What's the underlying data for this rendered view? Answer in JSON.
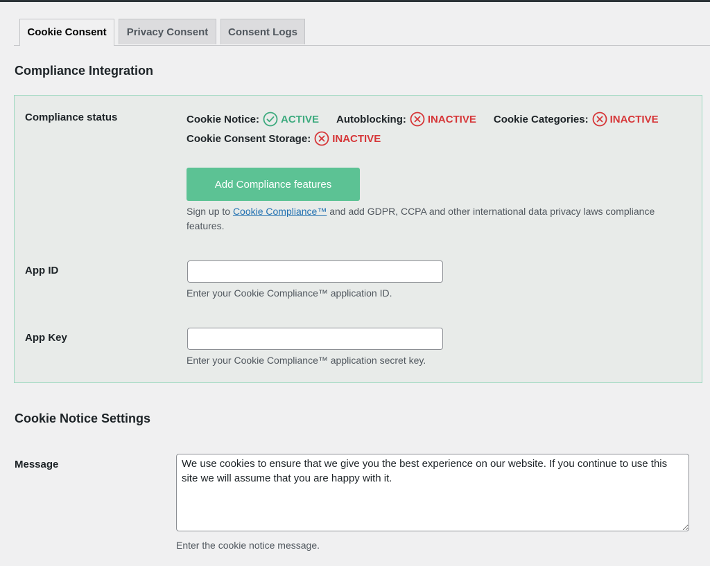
{
  "tabs": [
    {
      "label": "Cookie Consent",
      "active": true
    },
    {
      "label": "Privacy Consent",
      "active": false
    },
    {
      "label": "Consent Logs",
      "active": false
    }
  ],
  "compliance": {
    "heading": "Compliance Integration",
    "status_label": "Compliance status",
    "statuses": [
      {
        "label": "Cookie Notice:",
        "state": "ACTIVE",
        "icon": "check-circle-icon"
      },
      {
        "label": "Autoblocking:",
        "state": "INACTIVE",
        "icon": "x-circle-icon"
      },
      {
        "label": "Cookie Categories:",
        "state": "INACTIVE",
        "icon": "x-circle-icon"
      },
      {
        "label": "Cookie Consent Storage:",
        "state": "INACTIVE",
        "icon": "x-circle-icon"
      }
    ],
    "add_button": "Add Compliance features",
    "signup_prefix": "Sign up to ",
    "signup_link": "Cookie Compliance™",
    "signup_suffix": " and add GDPR, CCPA and other international data privacy laws compliance features.",
    "app_id": {
      "label": "App ID",
      "value": "",
      "hint": "Enter your Cookie Compliance™ application ID."
    },
    "app_key": {
      "label": "App Key",
      "value": "",
      "hint": "Enter your Cookie Compliance™ application secret key."
    }
  },
  "notice_settings": {
    "heading": "Cookie Notice Settings",
    "message_label": "Message",
    "message_value": "We use cookies to ensure that we give you the best experience on our website. If you continue to use this site we will assume that you are happy with it.",
    "message_hint": "Enter the cookie notice message."
  },
  "colors": {
    "active": "#3daa7e",
    "inactive": "#d63638",
    "button": "#5cc294",
    "box_border": "#9cd8bf",
    "link": "#2271b1"
  }
}
